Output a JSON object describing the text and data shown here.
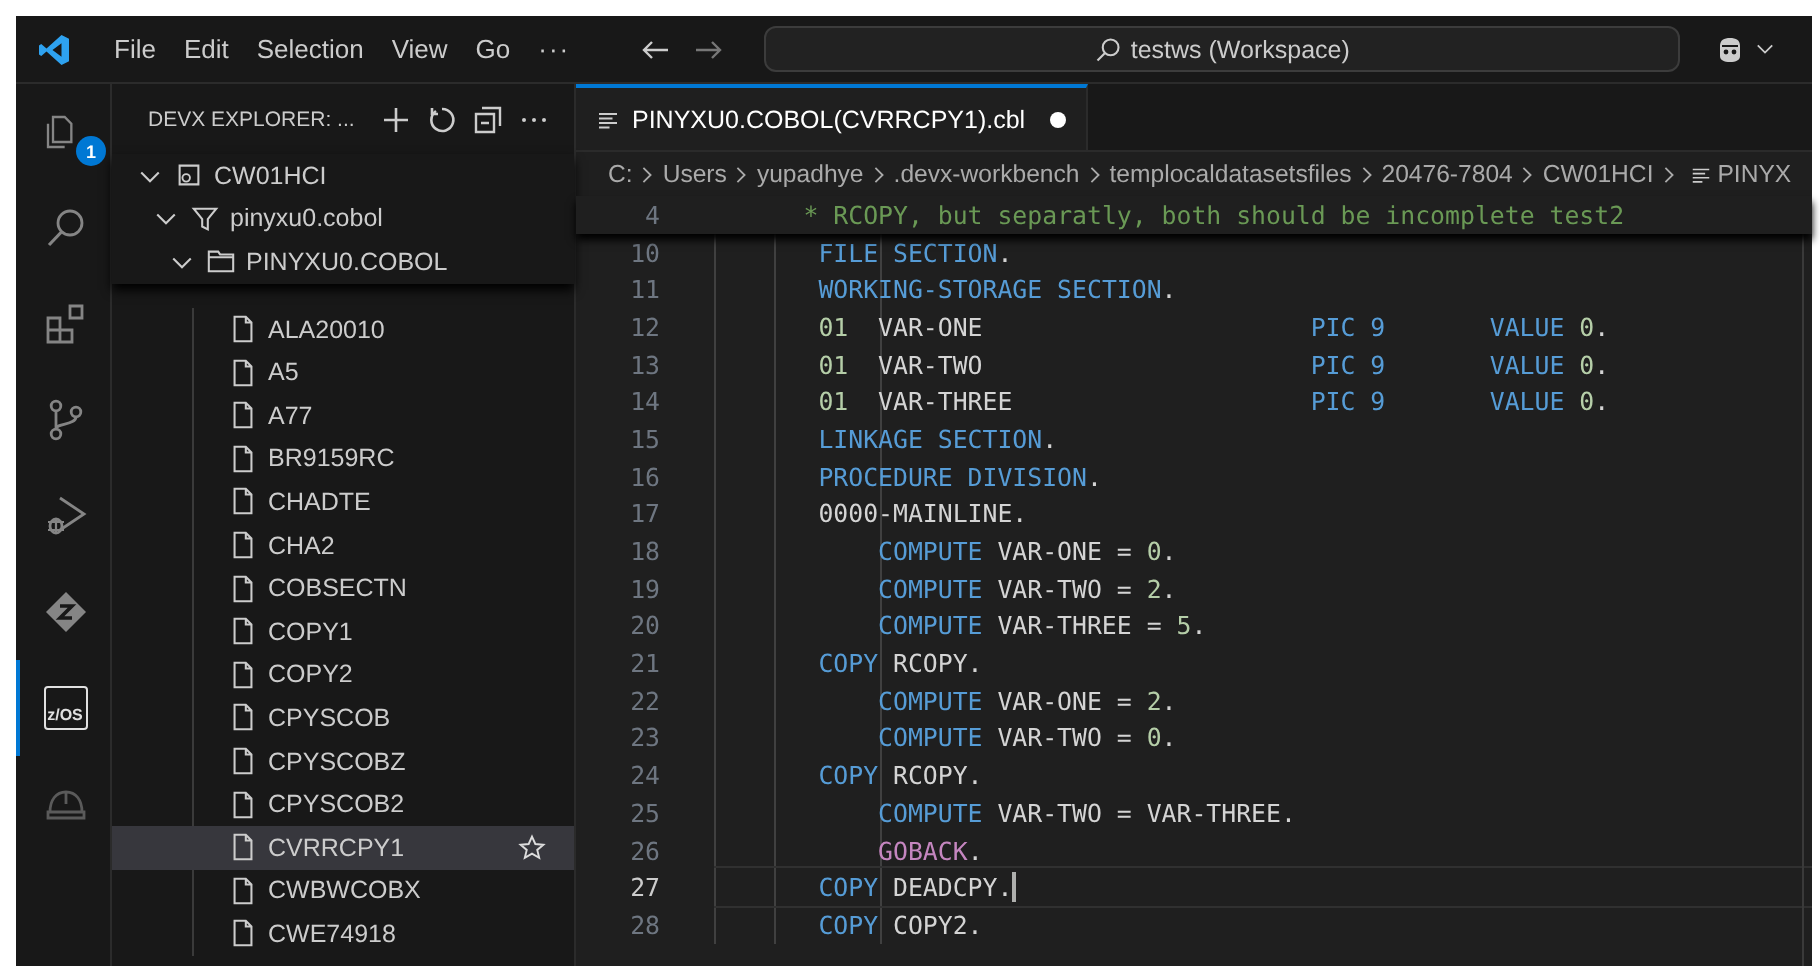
{
  "title_bar": {
    "menus": [
      "File",
      "Edit",
      "Selection",
      "View",
      "Go"
    ],
    "more": "···",
    "command_center": "testws (Workspace)"
  },
  "activity_bar": [
    {
      "kind": "explorer",
      "selected": false,
      "badge": "1"
    },
    {
      "kind": "search",
      "selected": false
    },
    {
      "kind": "extensions",
      "selected": false
    },
    {
      "kind": "source-control",
      "selected": false
    },
    {
      "kind": "run-debug",
      "selected": false
    },
    {
      "kind": "zowe",
      "selected": false
    },
    {
      "kind": "zos",
      "selected": true,
      "label": "z/OS"
    },
    {
      "kind": "helmet",
      "selected": false
    }
  ],
  "sidebar": {
    "title": "DEVX EXPLORER: ...",
    "tree": [
      {
        "kind": "system",
        "label": "CW01HCI",
        "expanded": true,
        "selected": false,
        "children": [
          {
            "kind": "filter",
            "label": "pinyxu0.cobol",
            "expanded": true,
            "selected": false,
            "children": [
              {
                "kind": "dataset",
                "label": "PINYXU0.COBOL",
                "expanded": true,
                "selected": false,
                "children": [
                  {
                    "kind": "member",
                    "label": "ALA20010",
                    "selected": false
                  },
                  {
                    "kind": "member",
                    "label": "A5",
                    "selected": false
                  },
                  {
                    "kind": "member",
                    "label": "A77",
                    "selected": false
                  },
                  {
                    "kind": "member",
                    "label": "BR9159RC",
                    "selected": false
                  },
                  {
                    "kind": "member",
                    "label": "CHADTE",
                    "selected": false
                  },
                  {
                    "kind": "member",
                    "label": "CHA2",
                    "selected": false
                  },
                  {
                    "kind": "member",
                    "label": "COBSECTN",
                    "selected": false
                  },
                  {
                    "kind": "member",
                    "label": "COPY1",
                    "selected": false
                  },
                  {
                    "kind": "member",
                    "label": "COPY2",
                    "selected": false
                  },
                  {
                    "kind": "member",
                    "label": "CPYSCOB",
                    "selected": false
                  },
                  {
                    "kind": "member",
                    "label": "CPYSCOBZ",
                    "selected": false
                  },
                  {
                    "kind": "member",
                    "label": "CPYSCOB2",
                    "selected": false
                  },
                  {
                    "kind": "member",
                    "label": "CVRRCPY1",
                    "selected": true
                  },
                  {
                    "kind": "member",
                    "label": "CWBWCOBX",
                    "selected": false
                  },
                  {
                    "kind": "member",
                    "label": "CWE74918",
                    "selected": false
                  }
                ]
              }
            ]
          }
        ]
      }
    ]
  },
  "editor": {
    "tab": {
      "label": "PINYXU0.COBOL(CVRRCPY1).cbl",
      "modified": true,
      "selected": true
    },
    "breadcrumb": [
      "C:",
      "Users",
      "yupadhye",
      ".devx-workbench",
      "templocaldatasetsfiles",
      "20476-7804",
      "CW01HCI",
      "PINYX"
    ],
    "sticky_line": {
      "number": "4",
      "kind": "comment",
      "tokens": [
        {
          "kind": "comment",
          "text": "* RCOPY, but separatly, both should be incomplete test2"
        }
      ]
    },
    "lines": [
      {
        "number": "10",
        "kind": "division",
        "current": false,
        "tokens": [
          {
            "kind": "keyword",
            "text": "FILE SECTION"
          },
          {
            "kind": "punct",
            "text": "."
          }
        ]
      },
      {
        "number": "11",
        "kind": "division",
        "current": false,
        "tokens": [
          {
            "kind": "keyword",
            "text": "WORKING-STORAGE SECTION"
          },
          {
            "kind": "punct",
            "text": "."
          }
        ]
      },
      {
        "number": "12",
        "kind": "declaration",
        "current": false,
        "tokens": [
          {
            "kind": "number",
            "text": "01"
          },
          {
            "kind": "plain",
            "text": "VAR-ONE"
          },
          {
            "kind": "keyword",
            "text": "PIC 9"
          },
          {
            "kind": "keyword",
            "text": "VALUE"
          },
          {
            "kind": "number",
            "text": "0"
          },
          {
            "kind": "punct",
            "text": "."
          }
        ]
      },
      {
        "number": "13",
        "kind": "declaration",
        "current": false,
        "tokens": [
          {
            "kind": "number",
            "text": "01"
          },
          {
            "kind": "plain",
            "text": "VAR-TWO"
          },
          {
            "kind": "keyword",
            "text": "PIC 9"
          },
          {
            "kind": "keyword",
            "text": "VALUE"
          },
          {
            "kind": "number",
            "text": "0"
          },
          {
            "kind": "punct",
            "text": "."
          }
        ]
      },
      {
        "number": "14",
        "kind": "declaration",
        "current": false,
        "tokens": [
          {
            "kind": "number",
            "text": "01"
          },
          {
            "kind": "plain",
            "text": "VAR-THREE"
          },
          {
            "kind": "keyword",
            "text": "PIC 9"
          },
          {
            "kind": "keyword",
            "text": "VALUE"
          },
          {
            "kind": "number",
            "text": "0"
          },
          {
            "kind": "punct",
            "text": "."
          }
        ]
      },
      {
        "number": "15",
        "kind": "division",
        "current": false,
        "tokens": [
          {
            "kind": "keyword",
            "text": "LINKAGE SECTION"
          },
          {
            "kind": "punct",
            "text": "."
          }
        ]
      },
      {
        "number": "16",
        "kind": "division",
        "current": false,
        "tokens": [
          {
            "kind": "keyword",
            "text": "PROCEDURE DIVISION"
          },
          {
            "kind": "punct",
            "text": "."
          }
        ]
      },
      {
        "number": "17",
        "kind": "division",
        "current": false,
        "tokens": [
          {
            "kind": "plain",
            "text": "0000-MAINLINE."
          }
        ]
      },
      {
        "number": "18",
        "kind": "statement",
        "current": false,
        "tokens": [
          {
            "kind": "keyword",
            "text": "COMPUTE"
          },
          {
            "kind": "plain",
            "text": "VAR-ONE ="
          },
          {
            "kind": "number",
            "text": "0"
          },
          {
            "kind": "punct",
            "text": "."
          }
        ]
      },
      {
        "number": "19",
        "kind": "statement",
        "current": false,
        "tokens": [
          {
            "kind": "keyword",
            "text": "COMPUTE"
          },
          {
            "kind": "plain",
            "text": "VAR-TWO ="
          },
          {
            "kind": "number",
            "text": "2"
          },
          {
            "kind": "punct",
            "text": "."
          }
        ]
      },
      {
        "number": "20",
        "kind": "statement",
        "current": false,
        "tokens": [
          {
            "kind": "keyword",
            "text": "COMPUTE"
          },
          {
            "kind": "plain",
            "text": "VAR-THREE ="
          },
          {
            "kind": "number",
            "text": "5"
          },
          {
            "kind": "punct",
            "text": "."
          }
        ]
      },
      {
        "number": "21",
        "kind": "division",
        "current": false,
        "tokens": [
          {
            "kind": "keyword",
            "text": "COPY"
          },
          {
            "kind": "plain",
            "text": "RCOPY."
          }
        ]
      },
      {
        "number": "22",
        "kind": "statement",
        "current": false,
        "tokens": [
          {
            "kind": "keyword",
            "text": "COMPUTE"
          },
          {
            "kind": "plain",
            "text": "VAR-ONE ="
          },
          {
            "kind": "number",
            "text": "2"
          },
          {
            "kind": "punct",
            "text": "."
          }
        ]
      },
      {
        "number": "23",
        "kind": "statement",
        "current": false,
        "tokens": [
          {
            "kind": "keyword",
            "text": "COMPUTE"
          },
          {
            "kind": "plain",
            "text": "VAR-TWO ="
          },
          {
            "kind": "number",
            "text": "0"
          },
          {
            "kind": "punct",
            "text": "."
          }
        ]
      },
      {
        "number": "24",
        "kind": "division",
        "current": false,
        "tokens": [
          {
            "kind": "keyword",
            "text": "COPY"
          },
          {
            "kind": "plain",
            "text": "RCOPY."
          }
        ]
      },
      {
        "number": "25",
        "kind": "statement",
        "current": false,
        "tokens": [
          {
            "kind": "keyword",
            "text": "COMPUTE"
          },
          {
            "kind": "plain",
            "text": "VAR-TWO = VAR-THREE."
          }
        ]
      },
      {
        "number": "26",
        "kind": "statement",
        "current": false,
        "tokens": [
          {
            "kind": "control",
            "text": "GOBACK"
          },
          {
            "kind": "punct",
            "text": "."
          }
        ]
      },
      {
        "number": "27",
        "kind": "division",
        "current": true,
        "tokens": [
          {
            "kind": "keyword",
            "text": "COPY"
          },
          {
            "kind": "plain",
            "text": "DEADCPY."
          }
        ]
      },
      {
        "number": "28",
        "kind": "division",
        "current": false,
        "tokens": [
          {
            "kind": "keyword",
            "text": "COPY"
          },
          {
            "kind": "plain",
            "text": "COPY2."
          }
        ]
      }
    ]
  }
}
